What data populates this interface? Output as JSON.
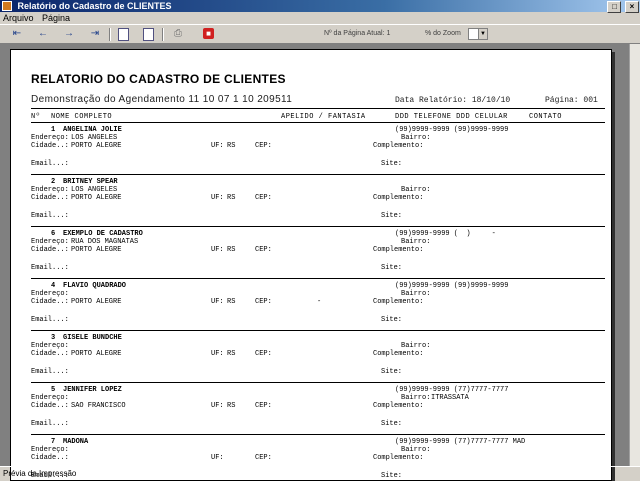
{
  "window": {
    "title": "Relatório do Cadastro de CLIENTES"
  },
  "menu": [
    "Arquivo",
    "Página"
  ],
  "toolbar": {
    "page_label": "Nº da Página Atual: 1",
    "zoom_label": "% do Zoom"
  },
  "report": {
    "title": "RELATORIO DO CADASTRO DE CLIENTES",
    "subtitle": "Demonstração do Agendamento 11 10 07 1 10 209511",
    "date": "Data Relatório: 18/10/10",
    "page": "Página: 001",
    "columns": {
      "num": "Nº",
      "name": "NOME COMPLETO",
      "nick": "APELIDO / FANTASIA",
      "phones": "DDD TELEFONE DDD CELULAR",
      "contact": "CONTATO"
    },
    "labels": {
      "endereco": "Endereço:",
      "bairro": "Bairro:",
      "cidade": "Cidade..:",
      "uf": "UF:",
      "cep": "CEP:",
      "complemento": "Complemento:",
      "email": "Email...:",
      "site": "Site:"
    },
    "records": [
      {
        "num": "1",
        "name": "ANGELINA JOLIE",
        "phones": "(99)9999-9999 (99)9999-9999",
        "endereco": "LOS ANGELES",
        "bairro": "",
        "cidade": "PORTO ALEGRE",
        "uf": "RS",
        "cep": "",
        "email": ""
      },
      {
        "num": "2",
        "name": "BRITNEY SPEAR",
        "phones": "",
        "endereco": "LOS ANGELES",
        "bairro": "",
        "cidade": "PORTO ALEGRE",
        "uf": "RS",
        "cep": "",
        "email": ""
      },
      {
        "num": "6",
        "name": "EXEMPLO DE CADASTRO",
        "phones": "(99)9999-9999 (  )     -",
        "endereco": "RUA DOS MAGNATAS",
        "bairro": "",
        "cidade": "PORTO ALEGRE",
        "uf": "RS",
        "cep": "",
        "email": ""
      },
      {
        "num": "4",
        "name": "FLAVIO QUADRADO",
        "phones": "(99)9999-9999 (99)9999-9999",
        "endereco": "",
        "bairro": "",
        "cidade": "PORTO ALEGRE",
        "uf": "RS",
        "cep": "-",
        "email": ""
      },
      {
        "num": "3",
        "name": "GISELE BUNDCHE",
        "phones": "",
        "endereco": "",
        "bairro": "",
        "cidade": "PORTO ALEGRE",
        "uf": "RS",
        "cep": "",
        "email": ""
      },
      {
        "num": "5",
        "name": "JENNIFER LOPEZ",
        "phones": "(99)9999-9999 (77)7777-7777",
        "endereco": "",
        "bairro": "ITRASSATA",
        "cidade": "SAO FRANCISCO",
        "uf": "RS",
        "cep": "",
        "email": ""
      },
      {
        "num": "7",
        "name": "MADONA",
        "phones": "(99)9999-9999 (77)7777-7777 MAD",
        "endereco": "",
        "bairro": "",
        "cidade": "",
        "uf": "",
        "cep": "",
        "email": ""
      }
    ]
  },
  "status": "Prévia da Impressão"
}
